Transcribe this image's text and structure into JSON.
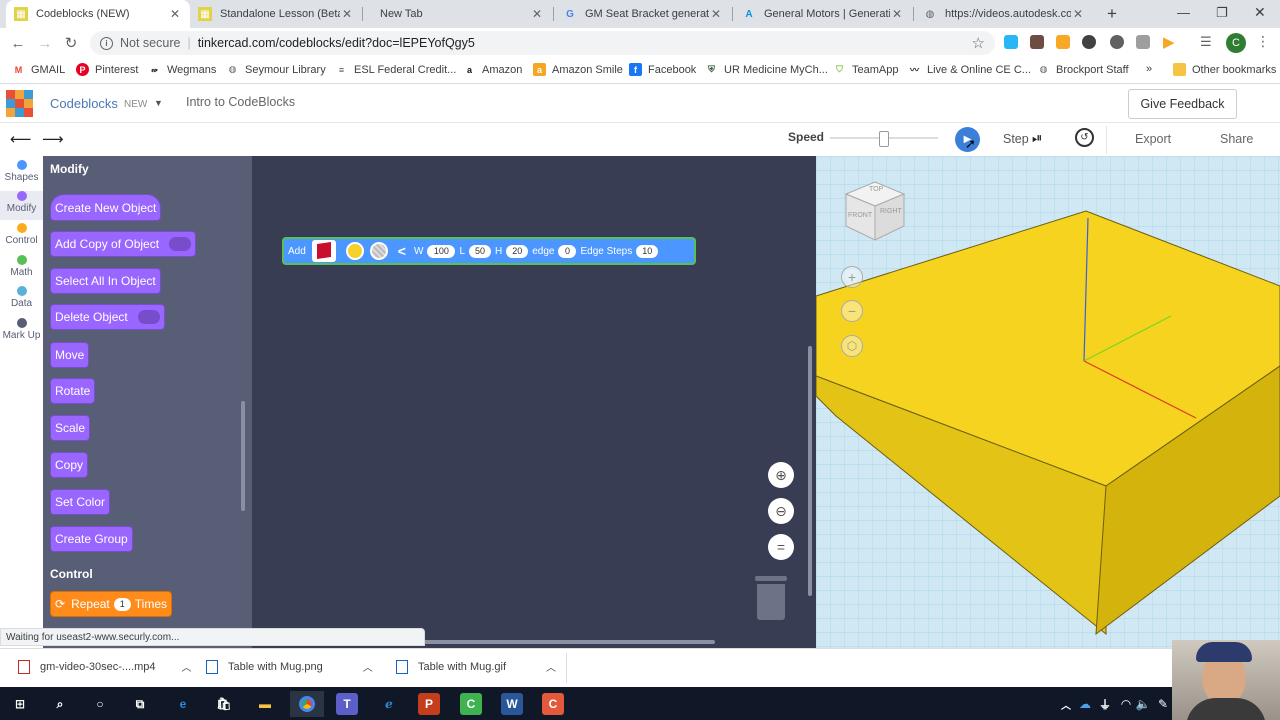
{
  "tabs": [
    {
      "title": "Codeblocks (NEW)",
      "active": true
    },
    {
      "title": "Standalone Lesson (Beta) | Ti"
    },
    {
      "title": "New Tab"
    },
    {
      "title": "GM Seat Bracket generative"
    },
    {
      "title": "General Motors | Generative"
    },
    {
      "title": "https://videos.autodesk.com"
    }
  ],
  "address": {
    "security": "Not secure",
    "url": "tinkercad.com/codeblocks/edit?doc=lEPEYofQgy5",
    "profile": "C"
  },
  "bookmarks": [
    "GMAIL",
    "Pinterest",
    "Wegmans",
    "Seymour Library",
    "ESL Federal Credit...",
    "Amazon",
    "Amazon Smile",
    "Facebook",
    "UR Medicine MyCh...",
    "TeamApp",
    "Live & Online CE C...",
    "Brockport Staff",
    "»",
    "Other bookmarks"
  ],
  "app": {
    "name": "Codeblocks",
    "badge": "NEW",
    "doc_title": "Intro to CodeBlocks",
    "feedback": "Give Feedback"
  },
  "toolbar": {
    "speed": "Speed",
    "step": "Step",
    "export": "Export",
    "share": "Share"
  },
  "categories": [
    {
      "label": "Shapes",
      "color": "#4c97ff"
    },
    {
      "label": "Modify",
      "color": "#9966ff"
    },
    {
      "label": "Control",
      "color": "#ffab19"
    },
    {
      "label": "Math",
      "color": "#59c059"
    },
    {
      "label": "Data",
      "color": "#5cb1d6"
    },
    {
      "label": "Mark Up",
      "color": "#575e75"
    }
  ],
  "flyout": {
    "modify_title": "Modify",
    "blocks": [
      "Create New Object",
      "Add Copy of Object",
      "Select All In Object",
      "Delete Object",
      "Move",
      "Rotate",
      "Scale",
      "Copy",
      "Set Color",
      "Create Group"
    ],
    "control_title": "Control",
    "repeat": {
      "label": "Repeat",
      "count": "1",
      "times": "Times"
    }
  },
  "add_block": {
    "label": "Add",
    "w_label": "W",
    "w": "100",
    "l_label": "L",
    "l": "50",
    "h_label": "H",
    "h": "20",
    "edge_label": "edge",
    "edge": "0",
    "steps_label": "Edge Steps",
    "steps": "10"
  },
  "viewcube": {
    "top": "TOP",
    "front": "FRONT",
    "right": "RIGHT"
  },
  "status": "Waiting for useast2-www.securly.com...",
  "downloads": [
    "gm-video-30sec-....mp4",
    "Table with Mug.png",
    "Table with Mug.gif"
  ]
}
